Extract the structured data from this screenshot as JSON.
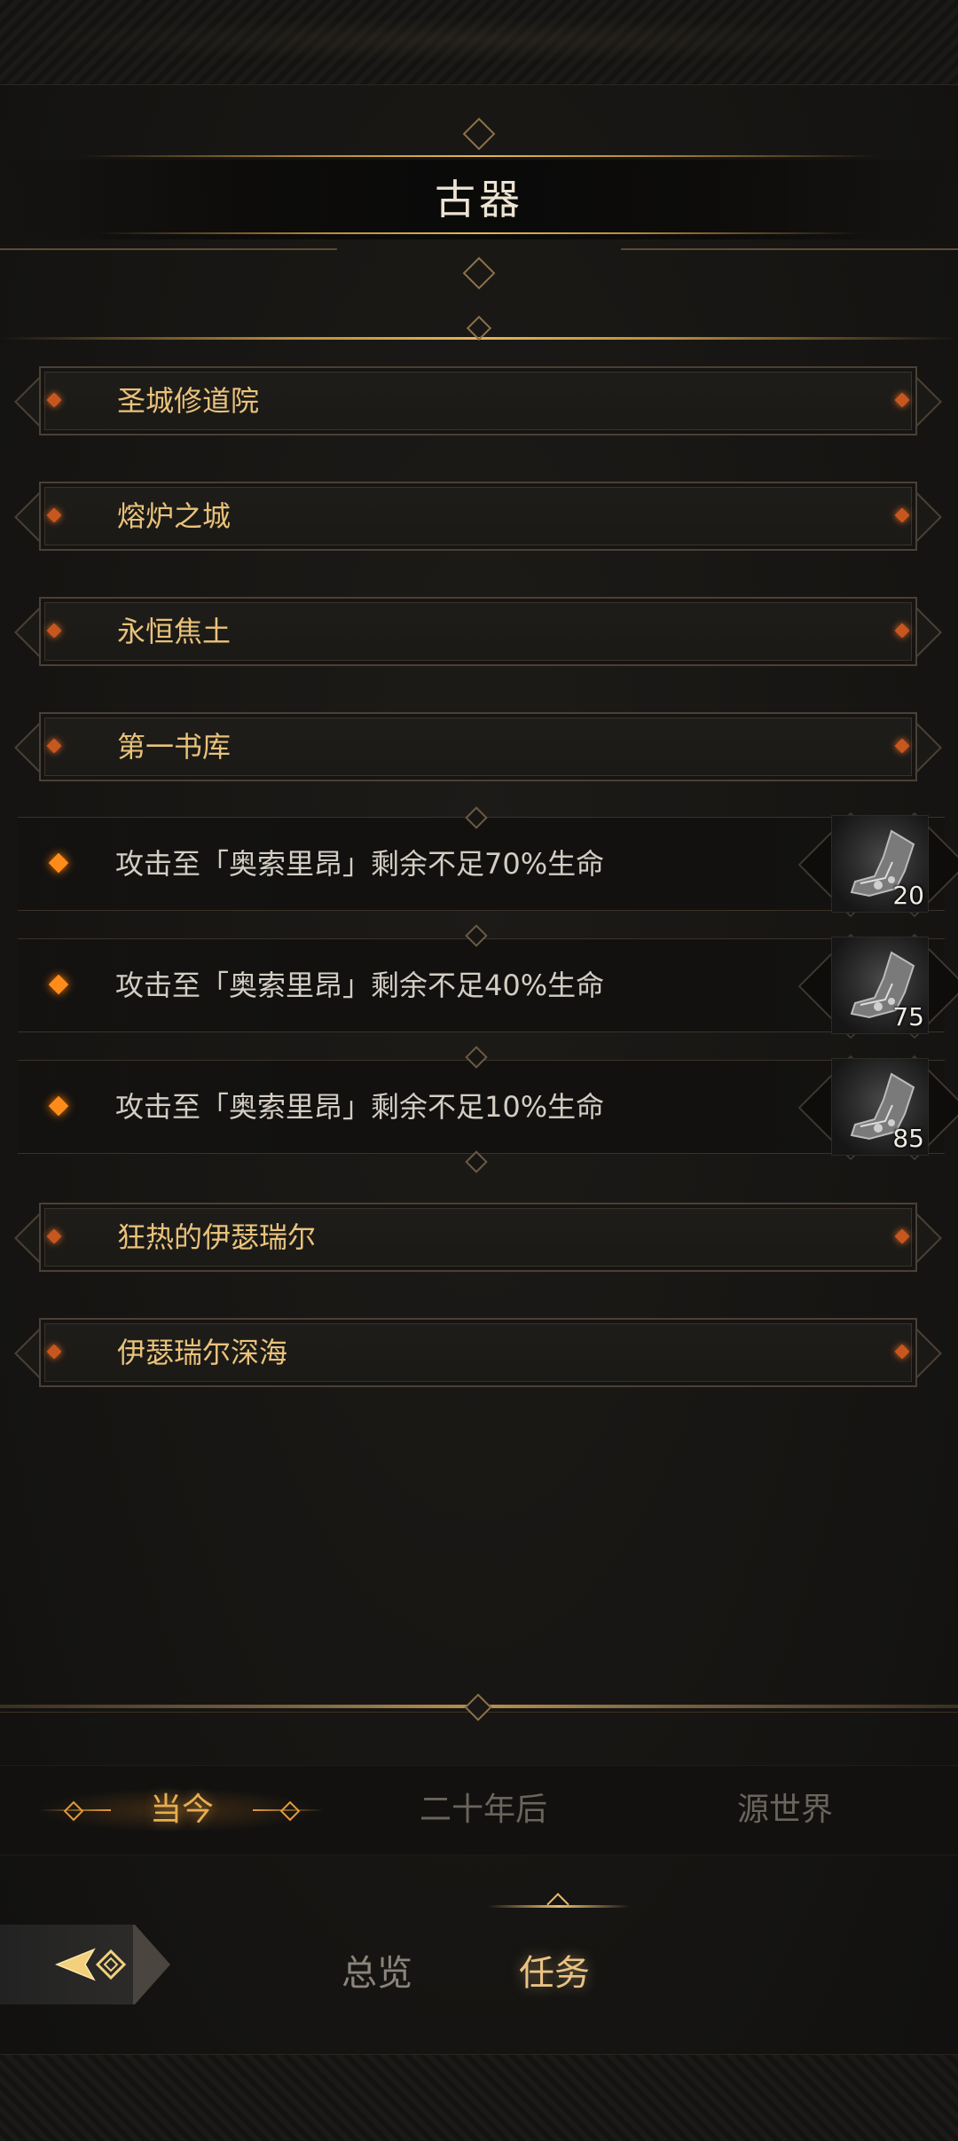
{
  "header": {
    "title": "古器"
  },
  "categories_top": [
    {
      "label": "圣城修道院"
    },
    {
      "label": "熔炉之城"
    },
    {
      "label": "永恒焦土"
    },
    {
      "label": "第一书库"
    }
  ],
  "tasks": [
    {
      "text": "攻击至「奥索里昂」剩余不足70%生命",
      "reward_count": "20",
      "reward_icon": "boot-icon"
    },
    {
      "text": "攻击至「奥索里昂」剩余不足40%生命",
      "reward_count": "75",
      "reward_icon": "boot-icon"
    },
    {
      "text": "攻击至「奥索里昂」剩余不足10%生命",
      "reward_count": "85",
      "reward_icon": "boot-icon"
    }
  ],
  "categories_bottom": [
    {
      "label": "狂热的伊瑟瑞尔"
    },
    {
      "label": "伊瑟瑞尔深海"
    }
  ],
  "eras": {
    "now": "当今",
    "twenty_years_later": "二十年后",
    "source_world": "源世界",
    "active": "now"
  },
  "tabs": {
    "overview": "总览",
    "tasks": "任务",
    "active": "tasks"
  },
  "colors": {
    "accent_gold": "#e9c27a",
    "active_orange": "#e7ad52",
    "bullet_orange": "#ff8c1a",
    "background": "#171614"
  }
}
